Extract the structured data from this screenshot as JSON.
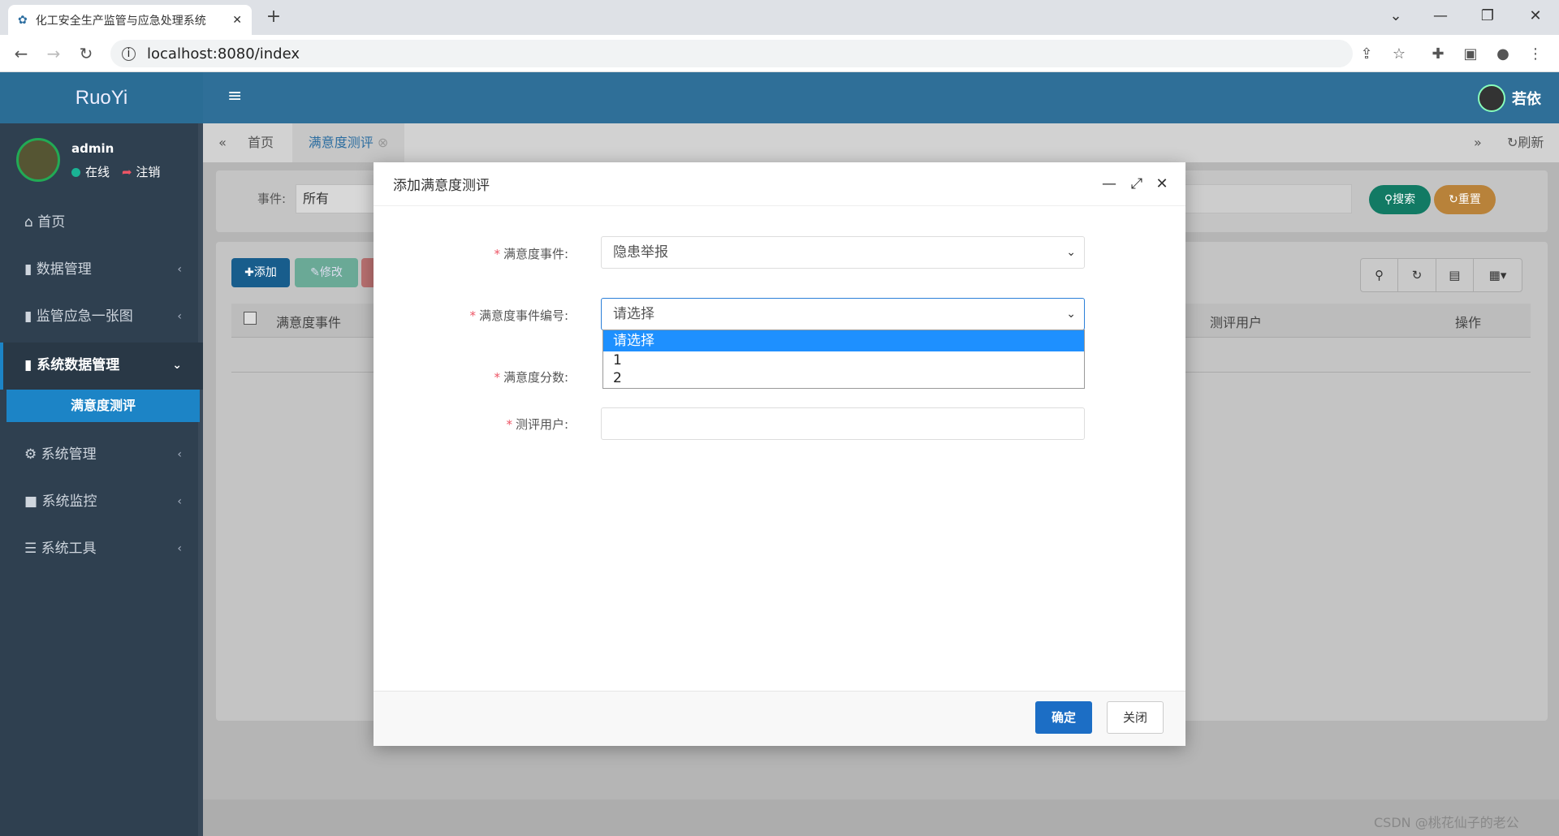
{
  "browser": {
    "tab_title": "化工安全生产监管与应急处理系统",
    "url": "localhost:8080/index",
    "new_tab": "+",
    "tab_close": "✕"
  },
  "app": {
    "logo": "RuoYi",
    "user_top": "若依"
  },
  "sidebar": {
    "user": "admin",
    "status": "在线",
    "logout": "注销",
    "items": [
      {
        "label": "首页",
        "icon": "home-icon"
      },
      {
        "label": "数据管理",
        "icon": "bookmark-icon"
      },
      {
        "label": "监管应急一张图",
        "icon": "bookmark-icon"
      },
      {
        "label": "系统数据管理",
        "icon": "bookmark-icon"
      },
      {
        "label": "满意度测评",
        "icon": ""
      },
      {
        "label": "系统管理",
        "icon": "gear-icon"
      },
      {
        "label": "系统监控",
        "icon": "video-icon"
      },
      {
        "label": "系统工具",
        "icon": "bars-icon"
      }
    ]
  },
  "page_tabs": {
    "home": "首页",
    "active": "满意度测评",
    "refresh": "刷新"
  },
  "search": {
    "label": "事件:",
    "value": "所有",
    "search_btn": "搜索",
    "reset_btn": "重置"
  },
  "toolbar": {
    "add": "添加",
    "edit": "修改"
  },
  "table": {
    "headers": [
      "满意度事件",
      "测评用户",
      "操作"
    ]
  },
  "modal": {
    "title": "添加满意度测评",
    "fields": [
      {
        "label": "满意度事件:",
        "value": "隐患举报"
      },
      {
        "label": "满意度事件编号:",
        "value": "请选择"
      },
      {
        "label": "满意度分数:",
        "value": ""
      },
      {
        "label": "测评用户:",
        "value": ""
      }
    ],
    "dropdown_options": [
      "请选择",
      "1",
      "2"
    ],
    "ok": "确定",
    "close": "关闭"
  },
  "watermark": "CSDN @桃花仙子的老公"
}
